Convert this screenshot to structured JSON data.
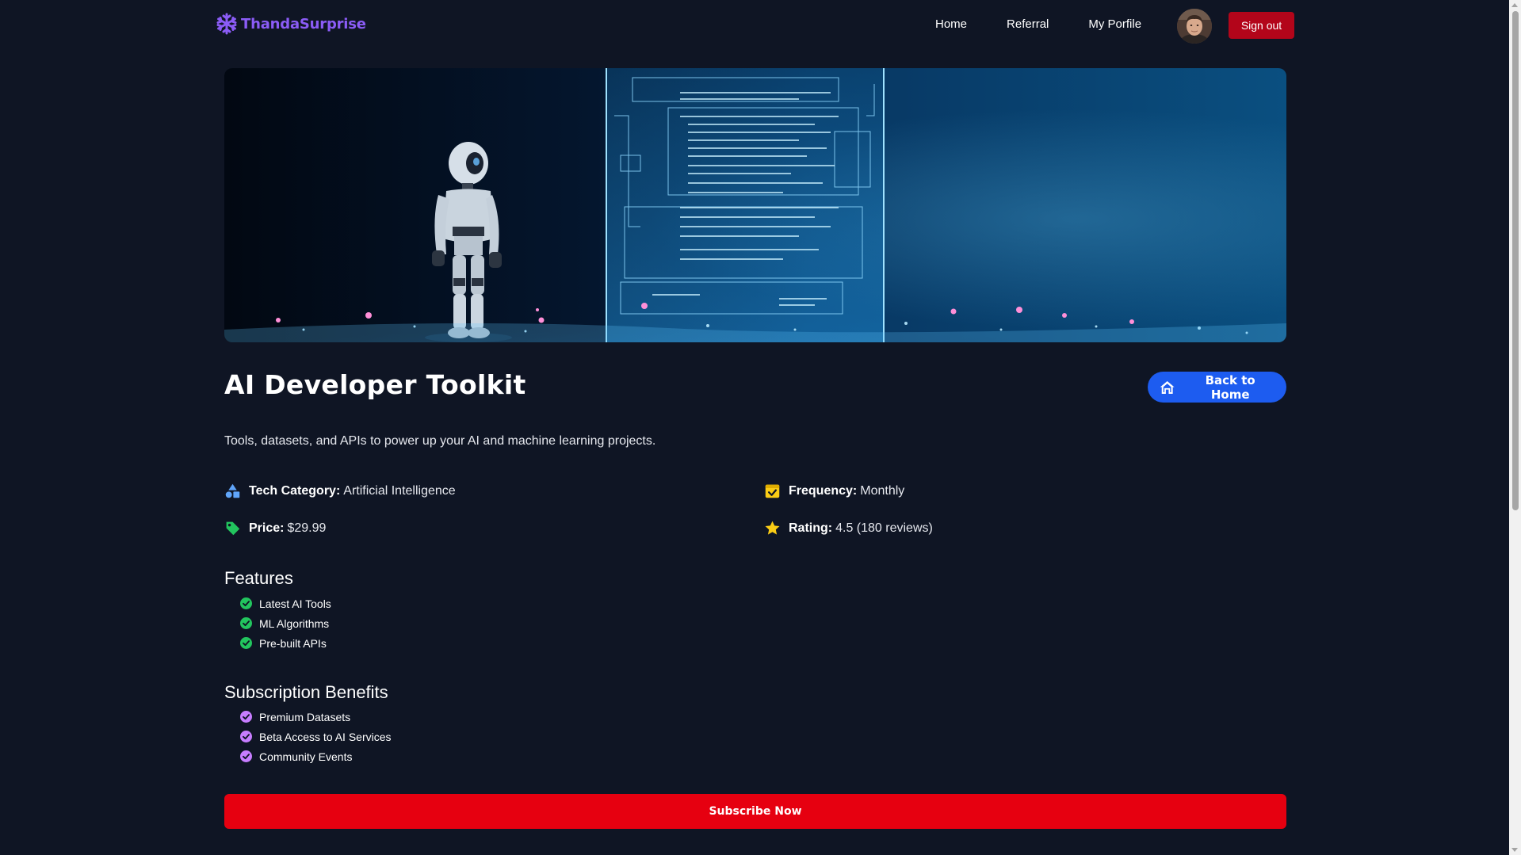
{
  "brand": {
    "name": "ThandaSurprise",
    "icon": "snowflake-icon",
    "color": "#8b5cf6"
  },
  "nav": {
    "links": [
      {
        "label": "Home"
      },
      {
        "label": "Referral"
      },
      {
        "label": "My Porfile"
      }
    ],
    "sign_out_label": "Sign out"
  },
  "product": {
    "title": "AI Developer Toolkit",
    "back_label": "Back to Home",
    "description": "Tools, datasets, and APIs to power up your AI and machine learning projects.",
    "meta": {
      "category": {
        "label": "Tech Category:",
        "value": "Artificial Intelligence",
        "icon": "shapes-icon"
      },
      "frequency": {
        "label": "Frequency:",
        "value": "Monthly",
        "icon": "calendar-check-icon"
      },
      "price": {
        "label": "Price:",
        "value": "$29.99",
        "icon": "tag-icon"
      },
      "rating": {
        "label": "Rating:",
        "value": "4.5 (180 reviews)",
        "icon": "star-icon"
      }
    },
    "features": {
      "heading": "Features",
      "items": [
        "Latest AI Tools",
        "ML Algorithms",
        "Pre-built APIs"
      ]
    },
    "benefits": {
      "heading": "Subscription Benefits",
      "items": [
        "Premium Datasets",
        "Beta Access to AI Services",
        "Community Events"
      ]
    },
    "subscribe_label": "Subscribe Now"
  },
  "colors": {
    "background": "#0f1524",
    "sign_out": "#b3051a",
    "back_button": "#1d5cf0",
    "subscribe": "#e60010",
    "feature_check": "#22c55e",
    "benefit_check": "#c77dff",
    "tag": "#22c55e",
    "calendar": "#facc15",
    "star": "#facc15",
    "category": "#60a5fa"
  }
}
